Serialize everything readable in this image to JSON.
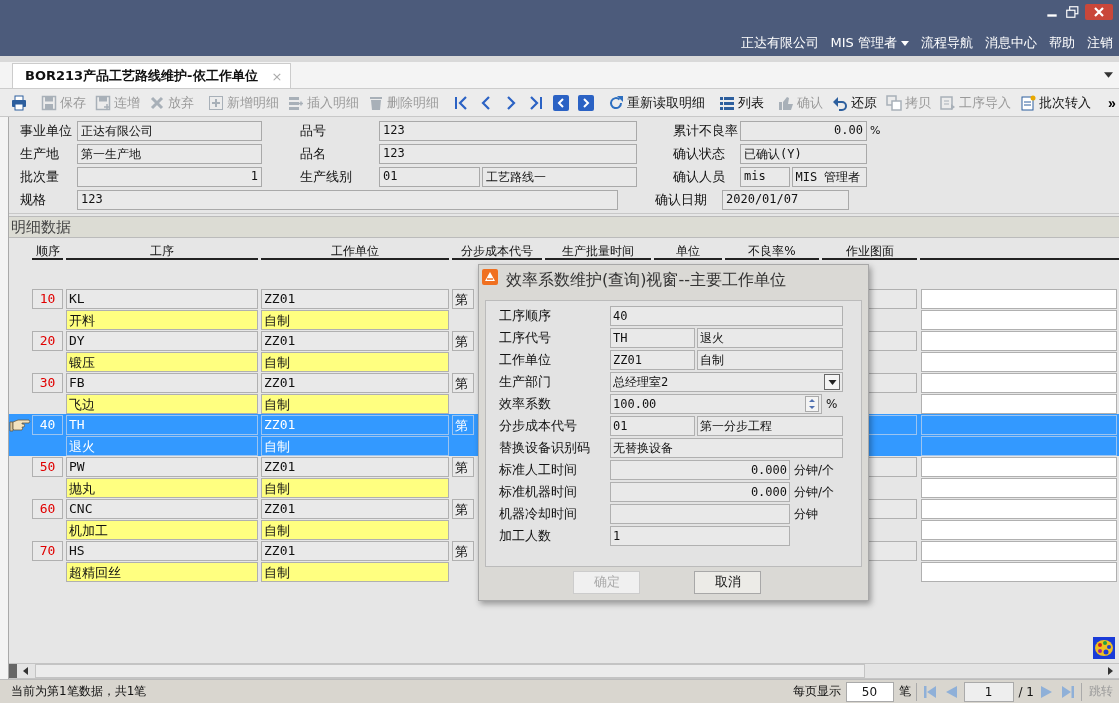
{
  "header": {
    "nav": [
      {
        "label": "正达有限公司",
        "dropdown": false
      },
      {
        "label": "MIS 管理者",
        "dropdown": true
      },
      {
        "label": "流程导航",
        "dropdown": false
      },
      {
        "label": "消息中心",
        "dropdown": false
      },
      {
        "label": "帮助",
        "dropdown": false
      },
      {
        "label": "注销",
        "dropdown": false
      }
    ]
  },
  "tabs": [
    {
      "label": "BOR213产品工艺路线维护-依工作单位",
      "selected": true,
      "close": "×"
    }
  ],
  "toolbar": {
    "groups": [
      [
        {
          "disabled": false
        }
      ],
      [
        {
          "label": "保存",
          "disabled": true
        },
        {
          "label": "连增",
          "disabled": true
        },
        {
          "label": "放弃",
          "disabled": true
        }
      ],
      [
        {
          "label": "新增明细",
          "disabled": true
        },
        {
          "label": "插入明细",
          "disabled": true
        },
        {
          "label": "删除明细",
          "disabled": true
        }
      ],
      [
        {
          "disabled": false
        },
        {
          "disabled": false
        },
        {
          "disabled": false
        },
        {
          "disabled": false
        },
        {
          "disabled": false
        },
        {
          "disabled": false
        }
      ],
      [
        {
          "label": "重新读取明细",
          "disabled": false
        }
      ],
      [
        {
          "label": "列表",
          "disabled": false
        }
      ],
      [
        {
          "label": "确认",
          "disabled": true
        },
        {
          "label": "还原",
          "disabled": false
        },
        {
          "label": "拷贝",
          "disabled": true
        },
        {
          "label": "工序导入",
          "disabled": true
        },
        {
          "label": "批次转入",
          "disabled": false
        }
      ]
    ],
    "overflow": "»"
  },
  "form": {
    "rows": [
      [
        {
          "label": "事业单位",
          "fields": [
            {
              "value": "正达有限公司",
              "kind": "text"
            }
          ]
        },
        {
          "label": "品号",
          "fields": [
            {
              "value": "123",
              "kind": "text"
            }
          ]
        },
        {
          "label": "累计不良率",
          "fields": [
            {
              "value": "0.00",
              "kind": "number"
            }
          ],
          "unit": "%"
        }
      ],
      [
        {
          "label": "生产地",
          "fields": [
            {
              "value": "第一生产地",
              "kind": "text"
            }
          ]
        },
        {
          "label": "品名",
          "fields": [
            {
              "value": "123",
              "kind": "text"
            }
          ]
        },
        {
          "label": "确认状态",
          "fields": [
            {
              "value": "已确认(Y)",
              "kind": "text"
            }
          ]
        }
      ],
      [
        {
          "label": "批次量",
          "fields": [
            {
              "value": "1",
              "kind": "number"
            }
          ]
        },
        {
          "label": "生产线别",
          "fields": [
            {
              "value": "01",
              "kind": "text"
            },
            {
              "value": "工艺路线一",
              "kind": "text"
            }
          ]
        },
        {
          "label": "确认人员",
          "fields": [
            {
              "value": "mis",
              "kind": "text"
            },
            {
              "value": "MIS 管理者",
              "kind": "text"
            }
          ]
        }
      ],
      [
        {
          "label": "规格",
          "fields": [
            {
              "value": "123",
              "kind": "text"
            }
          ]
        },
        "",
        {
          "label": "确认日期",
          "fields": [
            {
              "value": "2020/01/07",
              "kind": "text"
            }
          ]
        }
      ]
    ]
  },
  "detail": {
    "title": "明细数据",
    "columns": [
      "顺序",
      "工序",
      "工作单位",
      "分步成本代号",
      "生产批量时间",
      "单位",
      "不良率%",
      "作业图面"
    ],
    "rows": [
      {
        "seq": "10",
        "code": "KL",
        "name": "开料",
        "unit_code": "ZZ01",
        "unit_name": "自制",
        "step": "第",
        "selected": false
      },
      {
        "seq": "20",
        "code": "DY",
        "name": "锻压",
        "unit_code": "ZZ01",
        "unit_name": "自制",
        "step": "第",
        "selected": false
      },
      {
        "seq": "30",
        "code": "FB",
        "name": "飞边",
        "unit_code": "ZZ01",
        "unit_name": "自制",
        "step": "第",
        "selected": false
      },
      {
        "seq": "40",
        "code": "TH",
        "name": "退火",
        "unit_code": "ZZ01",
        "unit_name": "自制",
        "step": "第",
        "selected": true
      },
      {
        "seq": "50",
        "code": "PW",
        "name": "抛丸",
        "unit_code": "ZZ01",
        "unit_name": "自制",
        "step": "第",
        "selected": false
      },
      {
        "seq": "60",
        "code": "CNC",
        "name": "机加工",
        "unit_code": "ZZ01",
        "unit_name": "自制",
        "step": "第",
        "selected": false
      },
      {
        "seq": "70",
        "code": "HS",
        "name": "超精回丝",
        "unit_code": "ZZ01",
        "unit_name": "自制",
        "step": "第",
        "selected": false
      }
    ]
  },
  "dialog": {
    "title": "效率系数维护(查询)视窗--主要工作单位",
    "fields": [
      {
        "label": "工序顺序",
        "kind": "text",
        "values": [
          "40"
        ]
      },
      {
        "label": "工序代号",
        "kind": "split",
        "values": [
          "TH",
          "退火"
        ]
      },
      {
        "label": "工作单位",
        "kind": "split",
        "values": [
          "ZZ01",
          "自制"
        ]
      },
      {
        "label": "生产部门",
        "kind": "select",
        "values": [
          "总经理室2"
        ]
      },
      {
        "label": "效率系数",
        "kind": "spin",
        "values": [
          "100.00"
        ],
        "unit": "%"
      },
      {
        "label": "分步成本代号",
        "kind": "split",
        "values": [
          "01",
          "第一分步工程"
        ]
      },
      {
        "label": "替换设备识别码",
        "kind": "text",
        "values": [
          "无替换设备"
        ]
      },
      {
        "label": "标准人工时间",
        "kind": "short",
        "values": [
          "0.000"
        ],
        "unit": "分钟/个"
      },
      {
        "label": "标准机器时间",
        "kind": "short",
        "values": [
          "0.000"
        ],
        "unit": "分钟/个"
      },
      {
        "label": "机器冷却时间",
        "kind": "short",
        "unit": "分钟"
      },
      {
        "label": "加工人数",
        "kind": "short",
        "values": [
          "1"
        ]
      }
    ],
    "buttons": [
      {
        "label": "确定",
        "disabled": true
      },
      {
        "label": "取消",
        "disabled": false
      }
    ]
  },
  "status_bar": {
    "message": "当前为第1笔数据，共1笔",
    "page_size_label": "每页显示",
    "page_size": "50",
    "page_size_unit": "笔",
    "page": "1",
    "total": "/ 1",
    "jump": {
      "label": "跳转",
      "disabled": true
    }
  }
}
